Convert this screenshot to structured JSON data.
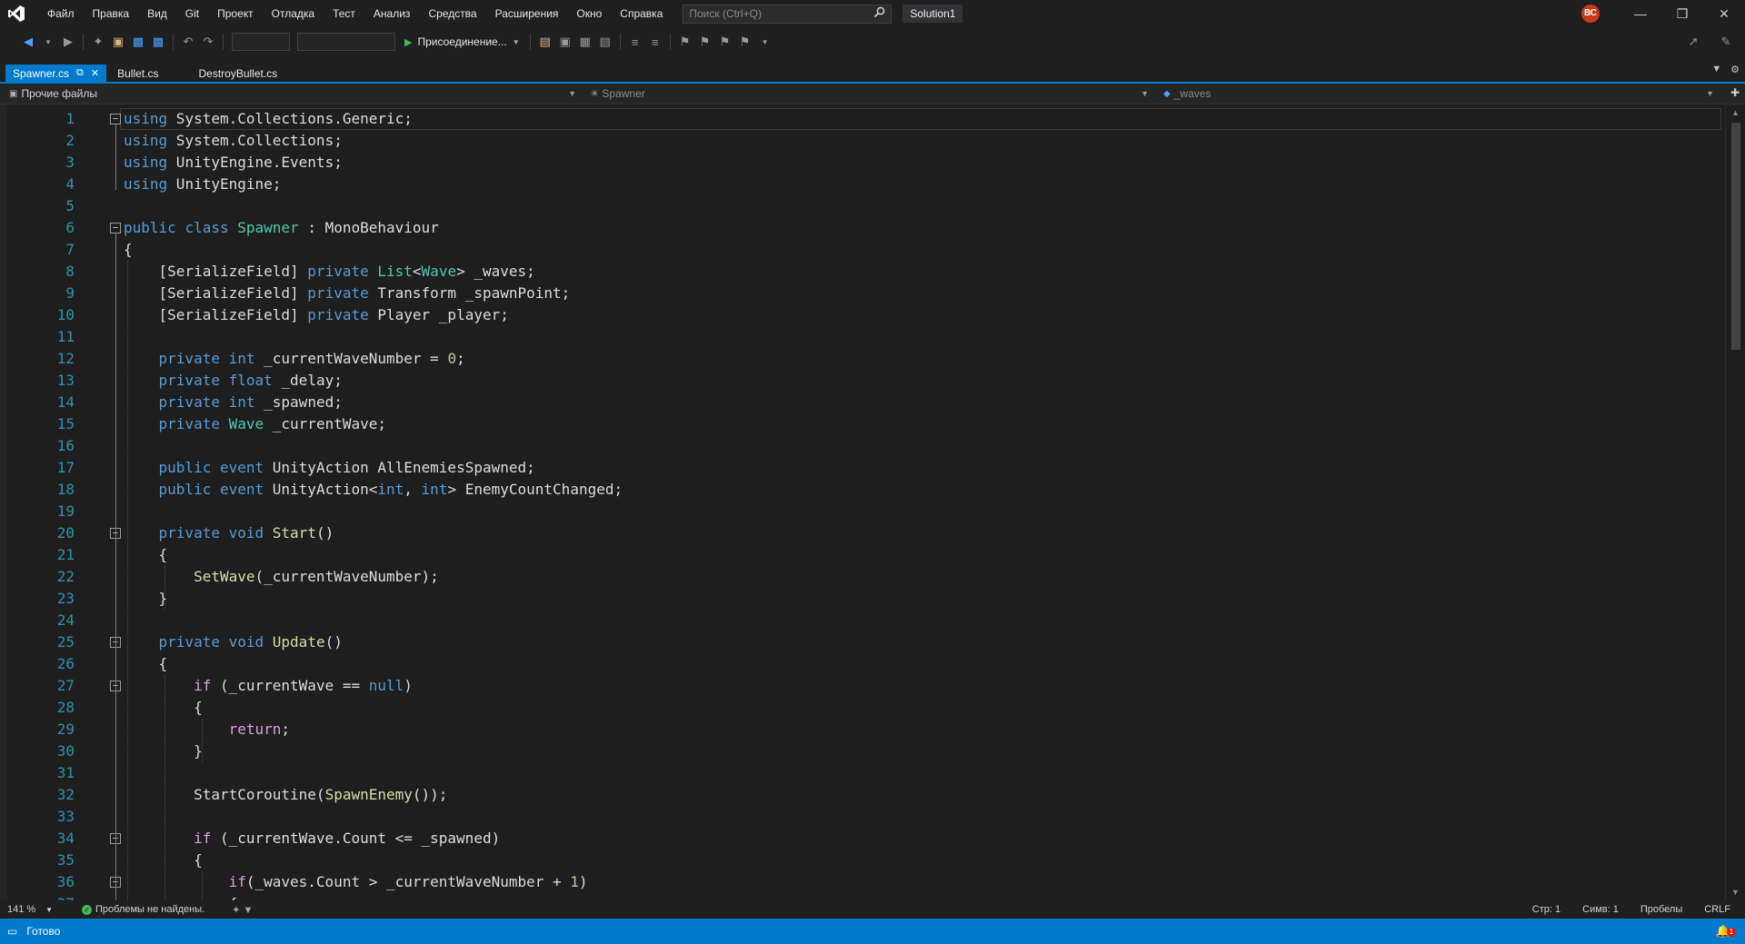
{
  "menu": [
    "Файл",
    "Правка",
    "Вид",
    "Git",
    "Проект",
    "Отладка",
    "Тест",
    "Анализ",
    "Средства",
    "Расширения",
    "Окно",
    "Справка"
  ],
  "search": {
    "placeholder": "Поиск (Ctrl+Q)"
  },
  "solution_name": "Solution1",
  "user_initials": "ВС",
  "toolbar": {
    "run_label": "Присоединение..."
  },
  "tabs": [
    {
      "label": "Spawner.cs",
      "active": true
    },
    {
      "label": "Bullet.cs",
      "active": false
    },
    {
      "label": "DestroyBullet.cs",
      "active": false
    }
  ],
  "navbar": {
    "project": "Прочие файлы",
    "type": "Spawner",
    "member": "_waves"
  },
  "code_lines": [
    [
      [
        "kw",
        "using"
      ],
      [
        "pl",
        " System.Collections.Generic;"
      ]
    ],
    [
      [
        "kw",
        "using"
      ],
      [
        "pl",
        " System.Collections;"
      ]
    ],
    [
      [
        "kw",
        "using"
      ],
      [
        "pl",
        " UnityEngine.Events;"
      ]
    ],
    [
      [
        "kw",
        "using"
      ],
      [
        "pl",
        " UnityEngine;"
      ]
    ],
    [],
    [
      [
        "kw",
        "public"
      ],
      [
        "pl",
        " "
      ],
      [
        "kw",
        "class"
      ],
      [
        "pl",
        " "
      ],
      [
        "ty",
        "Spawner"
      ],
      [
        "pl",
        " : MonoBehaviour"
      ]
    ],
    [
      [
        "pl",
        "{"
      ]
    ],
    [
      [
        "pl",
        "    [SerializeField] "
      ],
      [
        "kw",
        "private"
      ],
      [
        "pl",
        " "
      ],
      [
        "ty",
        "List"
      ],
      [
        "pl",
        "<"
      ],
      [
        "ty",
        "Wave"
      ],
      [
        "pl",
        "> _waves;"
      ]
    ],
    [
      [
        "pl",
        "    [SerializeField] "
      ],
      [
        "kw",
        "private"
      ],
      [
        "pl",
        " Transform _spawnPoint;"
      ]
    ],
    [
      [
        "pl",
        "    [SerializeField] "
      ],
      [
        "kw",
        "private"
      ],
      [
        "pl",
        " Player _player;"
      ]
    ],
    [],
    [
      [
        "pl",
        "    "
      ],
      [
        "kw",
        "private"
      ],
      [
        "pl",
        " "
      ],
      [
        "kw",
        "int"
      ],
      [
        "pl",
        " _currentWaveNumber = "
      ],
      [
        "nm",
        "0"
      ],
      [
        "pl",
        ";"
      ]
    ],
    [
      [
        "pl",
        "    "
      ],
      [
        "kw",
        "private"
      ],
      [
        "pl",
        " "
      ],
      [
        "kw",
        "float"
      ],
      [
        "pl",
        " _delay;"
      ]
    ],
    [
      [
        "pl",
        "    "
      ],
      [
        "kw",
        "private"
      ],
      [
        "pl",
        " "
      ],
      [
        "kw",
        "int"
      ],
      [
        "pl",
        " _spawned;"
      ]
    ],
    [
      [
        "pl",
        "    "
      ],
      [
        "kw",
        "private"
      ],
      [
        "pl",
        " "
      ],
      [
        "ty",
        "Wave"
      ],
      [
        "pl",
        " _currentWave;"
      ]
    ],
    [],
    [
      [
        "pl",
        "    "
      ],
      [
        "kw",
        "public"
      ],
      [
        "pl",
        " "
      ],
      [
        "kw",
        "event"
      ],
      [
        "pl",
        " UnityAction AllEnemiesSpawned;"
      ]
    ],
    [
      [
        "pl",
        "    "
      ],
      [
        "kw",
        "public"
      ],
      [
        "pl",
        " "
      ],
      [
        "kw",
        "event"
      ],
      [
        "pl",
        " UnityAction<"
      ],
      [
        "kw",
        "int"
      ],
      [
        "pl",
        ", "
      ],
      [
        "kw",
        "int"
      ],
      [
        "pl",
        "> EnemyCountChanged;"
      ]
    ],
    [],
    [
      [
        "pl",
        "    "
      ],
      [
        "kw",
        "private"
      ],
      [
        "pl",
        " "
      ],
      [
        "kw",
        "void"
      ],
      [
        "pl",
        " "
      ],
      [
        "fn",
        "Start"
      ],
      [
        "pl",
        "()"
      ]
    ],
    [
      [
        "pl",
        "    {"
      ]
    ],
    [
      [
        "pl",
        "        "
      ],
      [
        "fn",
        "SetWave"
      ],
      [
        "pl",
        "(_currentWaveNumber);"
      ]
    ],
    [
      [
        "pl",
        "    }"
      ]
    ],
    [],
    [
      [
        "pl",
        "    "
      ],
      [
        "kw",
        "private"
      ],
      [
        "pl",
        " "
      ],
      [
        "kw",
        "void"
      ],
      [
        "pl",
        " "
      ],
      [
        "fn",
        "Update"
      ],
      [
        "pl",
        "()"
      ]
    ],
    [
      [
        "pl",
        "    {"
      ]
    ],
    [
      [
        "pl",
        "        "
      ],
      [
        "ctl",
        "if"
      ],
      [
        "pl",
        " (_currentWave == "
      ],
      [
        "kw",
        "null"
      ],
      [
        "pl",
        ")"
      ]
    ],
    [
      [
        "pl",
        "        {"
      ]
    ],
    [
      [
        "pl",
        "            "
      ],
      [
        "ctl",
        "return"
      ],
      [
        "pl",
        ";"
      ]
    ],
    [
      [
        "pl",
        "        }"
      ]
    ],
    [],
    [
      [
        "pl",
        "        StartCoroutine("
      ],
      [
        "fn",
        "SpawnEnemy"
      ],
      [
        "pl",
        "());"
      ]
    ],
    [],
    [
      [
        "pl",
        "        "
      ],
      [
        "ctl",
        "if"
      ],
      [
        "pl",
        " (_currentWave.Count <= _spawned)"
      ]
    ],
    [
      [
        "pl",
        "        {"
      ]
    ],
    [
      [
        "pl",
        "            "
      ],
      [
        "ctl",
        "if"
      ],
      [
        "pl",
        "(_waves.Count > _currentWaveNumber + "
      ],
      [
        "nm",
        "1"
      ],
      [
        "pl",
        ")"
      ]
    ],
    [
      [
        "pl",
        "            {"
      ]
    ]
  ],
  "fold_lines": [
    1,
    6,
    20,
    25,
    27,
    34,
    36
  ],
  "infobar": {
    "zoom": "141 %",
    "issues": "Проблемы не найдены.",
    "line": "Стр: 1",
    "col": "Симв: 1",
    "spaces": "Пробелы",
    "eol": "CRLF"
  },
  "status": {
    "text": "Готово",
    "notifications": "1"
  },
  "colors": {
    "accent": "#007acc",
    "keyword": "#569cd6",
    "type": "#4ec9b0",
    "method": "#dcdcaa",
    "number": "#b5cea8",
    "control": "#d8a0df",
    "line_number": "#2b91af"
  }
}
